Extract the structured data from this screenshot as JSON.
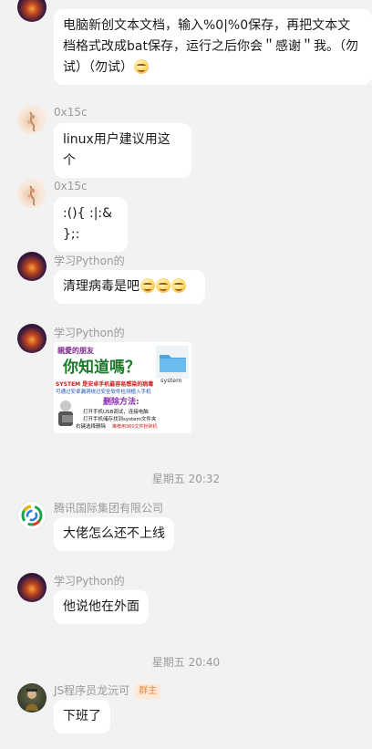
{
  "messages": [
    {
      "text": "电脑新创文本文档，输入%0|%0保存，再把文本文档格式改成bat保存，运行之后你会＂感谢＂我。（勿试）（勿试）"
    },
    {
      "sender": "0x15c",
      "text": "linux用户建议用这个"
    },
    {
      "sender": "0x15c",
      "text": ":(){ :|:& };:"
    },
    {
      "sender": "学习Python的",
      "text": "清理病毒是吧"
    },
    {
      "sender": "学习Python的",
      "sticker": {
        "line1": "親愛的朋友",
        "line2": "你知道嗎？",
        "folder_label": "system",
        "warn_red": "SYSTEM 是安卓手机最容易感染的病毒",
        "warn_blue": "可通过安卓漏洞绕过安全软件检测植入手机",
        "delete_title": "删除方法:",
        "steps": [
          "打开手机USB调试，连接电脑",
          "打开手机储存找到system文件夹",
          "右键选择删除"
        ],
        "note": "推荐用360文件粉碎机"
      }
    },
    {
      "timestamp": "星期五 20:32"
    },
    {
      "sender": "腾讯国际集团有限公司",
      "text": "大佬怎么还不上线"
    },
    {
      "sender": "学习Python的",
      "text": "他说他在外面"
    },
    {
      "timestamp": "星期五 20:40"
    },
    {
      "sender": "JS程序员龙沅可",
      "badge": "群主",
      "text": "下班了"
    }
  ],
  "icons": {
    "avatar_blossom": "blossom-avatar-icon",
    "avatar_space": "space-avatar-icon",
    "avatar_tencent": "tencent-logo-icon",
    "avatar_js": "game-character-avatar-icon",
    "emoji": "grin-emoji-icon"
  },
  "colors": {
    "background": "#f2f2f2",
    "bubble": "#ffffff",
    "meta_text": "#9a9a9a",
    "badge_bg": "#fde7d6",
    "badge_text": "#f08a3c"
  }
}
